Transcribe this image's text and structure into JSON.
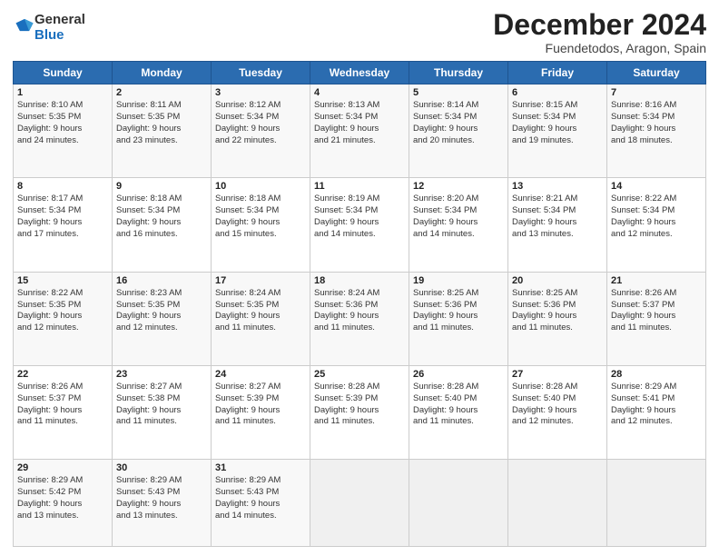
{
  "logo": {
    "general": "General",
    "blue": "Blue"
  },
  "title": "December 2024",
  "location": "Fuendetodos, Aragon, Spain",
  "days_header": [
    "Sunday",
    "Monday",
    "Tuesday",
    "Wednesday",
    "Thursday",
    "Friday",
    "Saturday"
  ],
  "weeks": [
    [
      {
        "day": "1",
        "lines": [
          "Sunrise: 8:10 AM",
          "Sunset: 5:35 PM",
          "Daylight: 9 hours",
          "and 24 minutes."
        ]
      },
      {
        "day": "2",
        "lines": [
          "Sunrise: 8:11 AM",
          "Sunset: 5:35 PM",
          "Daylight: 9 hours",
          "and 23 minutes."
        ]
      },
      {
        "day": "3",
        "lines": [
          "Sunrise: 8:12 AM",
          "Sunset: 5:34 PM",
          "Daylight: 9 hours",
          "and 22 minutes."
        ]
      },
      {
        "day": "4",
        "lines": [
          "Sunrise: 8:13 AM",
          "Sunset: 5:34 PM",
          "Daylight: 9 hours",
          "and 21 minutes."
        ]
      },
      {
        "day": "5",
        "lines": [
          "Sunrise: 8:14 AM",
          "Sunset: 5:34 PM",
          "Daylight: 9 hours",
          "and 20 minutes."
        ]
      },
      {
        "day": "6",
        "lines": [
          "Sunrise: 8:15 AM",
          "Sunset: 5:34 PM",
          "Daylight: 9 hours",
          "and 19 minutes."
        ]
      },
      {
        "day": "7",
        "lines": [
          "Sunrise: 8:16 AM",
          "Sunset: 5:34 PM",
          "Daylight: 9 hours",
          "and 18 minutes."
        ]
      }
    ],
    [
      {
        "day": "8",
        "lines": [
          "Sunrise: 8:17 AM",
          "Sunset: 5:34 PM",
          "Daylight: 9 hours",
          "and 17 minutes."
        ]
      },
      {
        "day": "9",
        "lines": [
          "Sunrise: 8:18 AM",
          "Sunset: 5:34 PM",
          "Daylight: 9 hours",
          "and 16 minutes."
        ]
      },
      {
        "day": "10",
        "lines": [
          "Sunrise: 8:18 AM",
          "Sunset: 5:34 PM",
          "Daylight: 9 hours",
          "and 15 minutes."
        ]
      },
      {
        "day": "11",
        "lines": [
          "Sunrise: 8:19 AM",
          "Sunset: 5:34 PM",
          "Daylight: 9 hours",
          "and 14 minutes."
        ]
      },
      {
        "day": "12",
        "lines": [
          "Sunrise: 8:20 AM",
          "Sunset: 5:34 PM",
          "Daylight: 9 hours",
          "and 14 minutes."
        ]
      },
      {
        "day": "13",
        "lines": [
          "Sunrise: 8:21 AM",
          "Sunset: 5:34 PM",
          "Daylight: 9 hours",
          "and 13 minutes."
        ]
      },
      {
        "day": "14",
        "lines": [
          "Sunrise: 8:22 AM",
          "Sunset: 5:34 PM",
          "Daylight: 9 hours",
          "and 12 minutes."
        ]
      }
    ],
    [
      {
        "day": "15",
        "lines": [
          "Sunrise: 8:22 AM",
          "Sunset: 5:35 PM",
          "Daylight: 9 hours",
          "and 12 minutes."
        ]
      },
      {
        "day": "16",
        "lines": [
          "Sunrise: 8:23 AM",
          "Sunset: 5:35 PM",
          "Daylight: 9 hours",
          "and 12 minutes."
        ]
      },
      {
        "day": "17",
        "lines": [
          "Sunrise: 8:24 AM",
          "Sunset: 5:35 PM",
          "Daylight: 9 hours",
          "and 11 minutes."
        ]
      },
      {
        "day": "18",
        "lines": [
          "Sunrise: 8:24 AM",
          "Sunset: 5:36 PM",
          "Daylight: 9 hours",
          "and 11 minutes."
        ]
      },
      {
        "day": "19",
        "lines": [
          "Sunrise: 8:25 AM",
          "Sunset: 5:36 PM",
          "Daylight: 9 hours",
          "and 11 minutes."
        ]
      },
      {
        "day": "20",
        "lines": [
          "Sunrise: 8:25 AM",
          "Sunset: 5:36 PM",
          "Daylight: 9 hours",
          "and 11 minutes."
        ]
      },
      {
        "day": "21",
        "lines": [
          "Sunrise: 8:26 AM",
          "Sunset: 5:37 PM",
          "Daylight: 9 hours",
          "and 11 minutes."
        ]
      }
    ],
    [
      {
        "day": "22",
        "lines": [
          "Sunrise: 8:26 AM",
          "Sunset: 5:37 PM",
          "Daylight: 9 hours",
          "and 11 minutes."
        ]
      },
      {
        "day": "23",
        "lines": [
          "Sunrise: 8:27 AM",
          "Sunset: 5:38 PM",
          "Daylight: 9 hours",
          "and 11 minutes."
        ]
      },
      {
        "day": "24",
        "lines": [
          "Sunrise: 8:27 AM",
          "Sunset: 5:39 PM",
          "Daylight: 9 hours",
          "and 11 minutes."
        ]
      },
      {
        "day": "25",
        "lines": [
          "Sunrise: 8:28 AM",
          "Sunset: 5:39 PM",
          "Daylight: 9 hours",
          "and 11 minutes."
        ]
      },
      {
        "day": "26",
        "lines": [
          "Sunrise: 8:28 AM",
          "Sunset: 5:40 PM",
          "Daylight: 9 hours",
          "and 11 minutes."
        ]
      },
      {
        "day": "27",
        "lines": [
          "Sunrise: 8:28 AM",
          "Sunset: 5:40 PM",
          "Daylight: 9 hours",
          "and 12 minutes."
        ]
      },
      {
        "day": "28",
        "lines": [
          "Sunrise: 8:29 AM",
          "Sunset: 5:41 PM",
          "Daylight: 9 hours",
          "and 12 minutes."
        ]
      }
    ],
    [
      {
        "day": "29",
        "lines": [
          "Sunrise: 8:29 AM",
          "Sunset: 5:42 PM",
          "Daylight: 9 hours",
          "and 13 minutes."
        ]
      },
      {
        "day": "30",
        "lines": [
          "Sunrise: 8:29 AM",
          "Sunset: 5:43 PM",
          "Daylight: 9 hours",
          "and 13 minutes."
        ]
      },
      {
        "day": "31",
        "lines": [
          "Sunrise: 8:29 AM",
          "Sunset: 5:43 PM",
          "Daylight: 9 hours",
          "and 14 minutes."
        ]
      },
      null,
      null,
      null,
      null
    ]
  ]
}
